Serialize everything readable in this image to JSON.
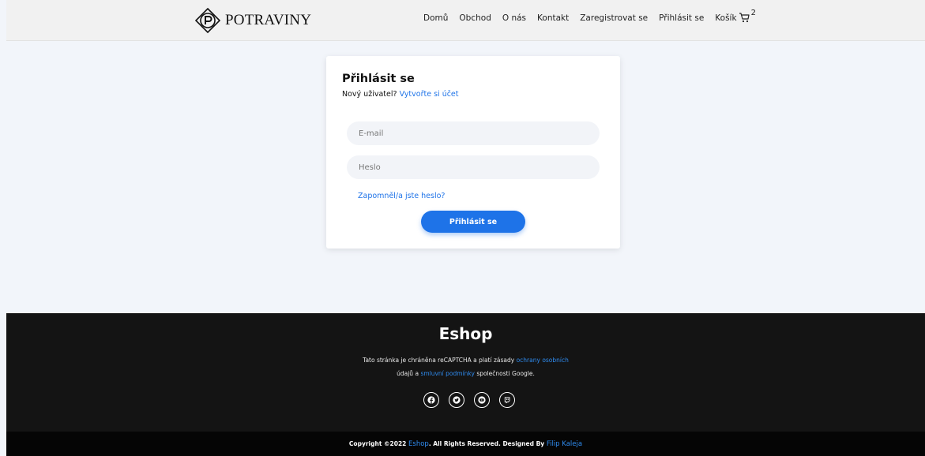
{
  "brand": {
    "name": "POTRAVINY",
    "logo_icon": "diamond-p-logo-icon"
  },
  "nav": {
    "items": [
      {
        "label": "Domů"
      },
      {
        "label": "Obchod"
      },
      {
        "label": "O nás"
      },
      {
        "label": "Kontakt"
      },
      {
        "label": "Zaregistrovat se"
      },
      {
        "label": "Přihlásit se"
      }
    ],
    "cart_label": "Košík",
    "cart_icon": "cart-icon",
    "cart_count": "2"
  },
  "login": {
    "title": "Přihlásit se",
    "new_user_text": "Nový uživatel?",
    "create_account_link": "Vytvořte si účet",
    "email_placeholder": "E-mail",
    "password_placeholder": "Heslo",
    "forgot_link": "Zapomněl/a jste heslo?",
    "submit_label": "Přihlásit se"
  },
  "footer": {
    "title": "Eshop",
    "recaptcha_pre": "Tato stránka je chráněna reCAPTCHA a platí zásady",
    "privacy_link": "ochrany osobních",
    "line2_pre": "údajů",
    "line2_and": "a",
    "terms_link": "smluvní podmínky",
    "line2_post": "společnosti Google.",
    "socials": [
      "facebook-icon",
      "twitter-icon",
      "youtube-icon",
      "twitch-icon"
    ]
  },
  "copyright": {
    "pre": "Copyright ©2022",
    "brand_link": "Eshop",
    "mid": ". All Rights Reserved. Designed By",
    "author_link": "Filip Kaleja"
  },
  "colors": {
    "accent": "#1e73e8",
    "footer_bg": "#141414",
    "copyright_bg": "#050505",
    "page_bg": "#f2f5fa",
    "navbar_bg": "#f1f1f1"
  }
}
